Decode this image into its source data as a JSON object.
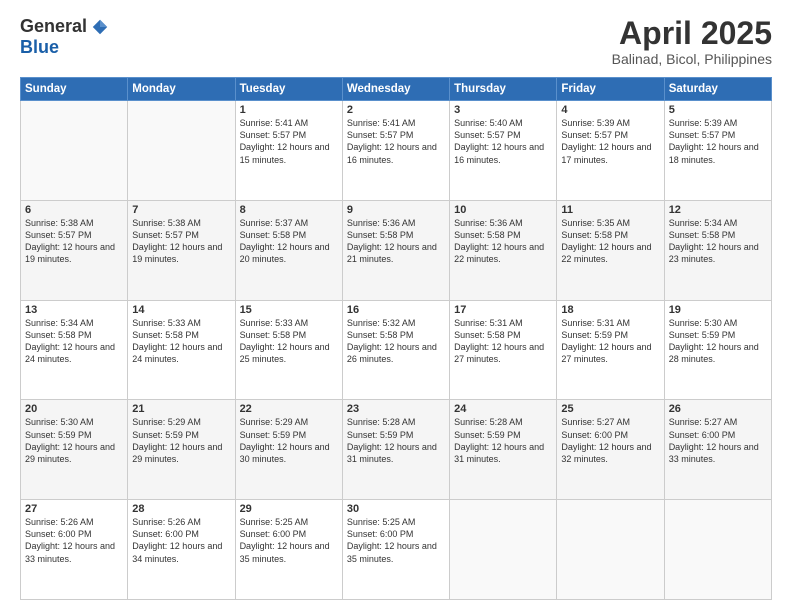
{
  "header": {
    "logo_general": "General",
    "logo_blue": "Blue",
    "title": "April 2025",
    "location": "Balinad, Bicol, Philippines"
  },
  "days_of_week": [
    "Sunday",
    "Monday",
    "Tuesday",
    "Wednesday",
    "Thursday",
    "Friday",
    "Saturday"
  ],
  "weeks": [
    [
      {
        "day": "",
        "content": ""
      },
      {
        "day": "",
        "content": ""
      },
      {
        "day": "1",
        "content": "Sunrise: 5:41 AM\nSunset: 5:57 PM\nDaylight: 12 hours and 15 minutes."
      },
      {
        "day": "2",
        "content": "Sunrise: 5:41 AM\nSunset: 5:57 PM\nDaylight: 12 hours and 16 minutes."
      },
      {
        "day": "3",
        "content": "Sunrise: 5:40 AM\nSunset: 5:57 PM\nDaylight: 12 hours and 16 minutes."
      },
      {
        "day": "4",
        "content": "Sunrise: 5:39 AM\nSunset: 5:57 PM\nDaylight: 12 hours and 17 minutes."
      },
      {
        "day": "5",
        "content": "Sunrise: 5:39 AM\nSunset: 5:57 PM\nDaylight: 12 hours and 18 minutes."
      }
    ],
    [
      {
        "day": "6",
        "content": "Sunrise: 5:38 AM\nSunset: 5:57 PM\nDaylight: 12 hours and 19 minutes."
      },
      {
        "day": "7",
        "content": "Sunrise: 5:38 AM\nSunset: 5:57 PM\nDaylight: 12 hours and 19 minutes."
      },
      {
        "day": "8",
        "content": "Sunrise: 5:37 AM\nSunset: 5:58 PM\nDaylight: 12 hours and 20 minutes."
      },
      {
        "day": "9",
        "content": "Sunrise: 5:36 AM\nSunset: 5:58 PM\nDaylight: 12 hours and 21 minutes."
      },
      {
        "day": "10",
        "content": "Sunrise: 5:36 AM\nSunset: 5:58 PM\nDaylight: 12 hours and 22 minutes."
      },
      {
        "day": "11",
        "content": "Sunrise: 5:35 AM\nSunset: 5:58 PM\nDaylight: 12 hours and 22 minutes."
      },
      {
        "day": "12",
        "content": "Sunrise: 5:34 AM\nSunset: 5:58 PM\nDaylight: 12 hours and 23 minutes."
      }
    ],
    [
      {
        "day": "13",
        "content": "Sunrise: 5:34 AM\nSunset: 5:58 PM\nDaylight: 12 hours and 24 minutes."
      },
      {
        "day": "14",
        "content": "Sunrise: 5:33 AM\nSunset: 5:58 PM\nDaylight: 12 hours and 24 minutes."
      },
      {
        "day": "15",
        "content": "Sunrise: 5:33 AM\nSunset: 5:58 PM\nDaylight: 12 hours and 25 minutes."
      },
      {
        "day": "16",
        "content": "Sunrise: 5:32 AM\nSunset: 5:58 PM\nDaylight: 12 hours and 26 minutes."
      },
      {
        "day": "17",
        "content": "Sunrise: 5:31 AM\nSunset: 5:58 PM\nDaylight: 12 hours and 27 minutes."
      },
      {
        "day": "18",
        "content": "Sunrise: 5:31 AM\nSunset: 5:59 PM\nDaylight: 12 hours and 27 minutes."
      },
      {
        "day": "19",
        "content": "Sunrise: 5:30 AM\nSunset: 5:59 PM\nDaylight: 12 hours and 28 minutes."
      }
    ],
    [
      {
        "day": "20",
        "content": "Sunrise: 5:30 AM\nSunset: 5:59 PM\nDaylight: 12 hours and 29 minutes."
      },
      {
        "day": "21",
        "content": "Sunrise: 5:29 AM\nSunset: 5:59 PM\nDaylight: 12 hours and 29 minutes."
      },
      {
        "day": "22",
        "content": "Sunrise: 5:29 AM\nSunset: 5:59 PM\nDaylight: 12 hours and 30 minutes."
      },
      {
        "day": "23",
        "content": "Sunrise: 5:28 AM\nSunset: 5:59 PM\nDaylight: 12 hours and 31 minutes."
      },
      {
        "day": "24",
        "content": "Sunrise: 5:28 AM\nSunset: 5:59 PM\nDaylight: 12 hours and 31 minutes."
      },
      {
        "day": "25",
        "content": "Sunrise: 5:27 AM\nSunset: 6:00 PM\nDaylight: 12 hours and 32 minutes."
      },
      {
        "day": "26",
        "content": "Sunrise: 5:27 AM\nSunset: 6:00 PM\nDaylight: 12 hours and 33 minutes."
      }
    ],
    [
      {
        "day": "27",
        "content": "Sunrise: 5:26 AM\nSunset: 6:00 PM\nDaylight: 12 hours and 33 minutes."
      },
      {
        "day": "28",
        "content": "Sunrise: 5:26 AM\nSunset: 6:00 PM\nDaylight: 12 hours and 34 minutes."
      },
      {
        "day": "29",
        "content": "Sunrise: 5:25 AM\nSunset: 6:00 PM\nDaylight: 12 hours and 35 minutes."
      },
      {
        "day": "30",
        "content": "Sunrise: 5:25 AM\nSunset: 6:00 PM\nDaylight: 12 hours and 35 minutes."
      },
      {
        "day": "",
        "content": ""
      },
      {
        "day": "",
        "content": ""
      },
      {
        "day": "",
        "content": ""
      }
    ]
  ]
}
